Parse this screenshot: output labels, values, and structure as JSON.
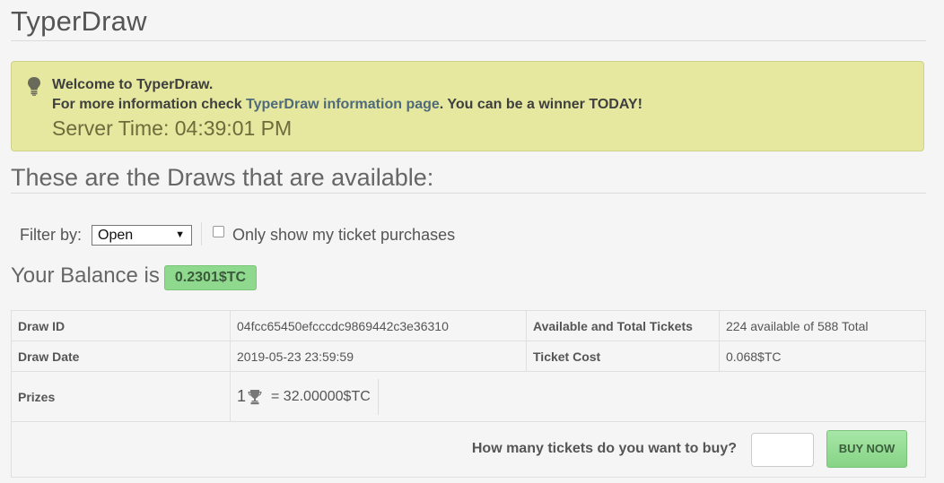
{
  "header": {
    "title": "TyperDraw"
  },
  "alert": {
    "line1": "Welcome to TyperDraw.",
    "line2_prefix": "For more information check ",
    "link_text": "TyperDraw information page",
    "line2_suffix": ". You can be a winner TODAY!",
    "server_time": "Server Time: 04:39:01 PM",
    "icon": "lightbulb-icon"
  },
  "draws": {
    "heading": "These are the Draws that are available:"
  },
  "filter": {
    "label": "Filter by:",
    "selected": "Open",
    "only_mine_label": "Only show my ticket purchases",
    "only_mine_checked": false
  },
  "balance": {
    "label": "Your Balance is",
    "value": "0.2301$TC",
    "badge_color": "#8fd98f"
  },
  "draw": {
    "draw_id_label": "Draw ID",
    "draw_id": "04fcc65450efcccdc9869442c3e36310",
    "tickets_label": "Available and Total Tickets",
    "tickets_value": "224 available of 588 Total",
    "date_label": "Draw Date",
    "date_value": "2019-05-23 23:59:59",
    "cost_label": "Ticket Cost",
    "cost_value": "0.068$TC",
    "prizes_label": "Prizes",
    "prizes": [
      {
        "rank": "1",
        "amount": "= 32.00000$TC",
        "icon": "trophy-icon"
      }
    ]
  },
  "buy": {
    "question": "How many tickets do you want to buy?",
    "quantity_value": "",
    "button_label": "BUY NOW",
    "button_color": "#8fd98f"
  }
}
